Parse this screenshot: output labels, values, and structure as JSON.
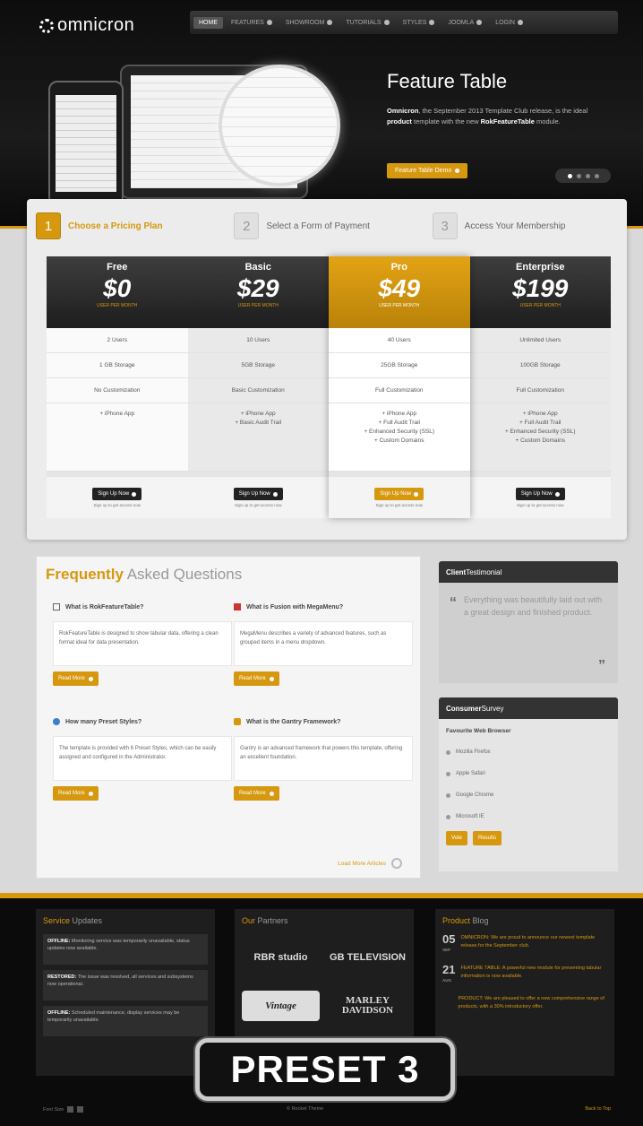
{
  "header": {
    "logo": "omnicron",
    "nav": [
      {
        "label": "HOME",
        "active": true,
        "dropdown": false
      },
      {
        "label": "FEATURES",
        "active": false,
        "dropdown": true
      },
      {
        "label": "SHOWROOM",
        "active": false,
        "dropdown": true
      },
      {
        "label": "TUTORIALS",
        "active": false,
        "dropdown": true
      },
      {
        "label": "STYLES",
        "active": false,
        "dropdown": true
      },
      {
        "label": "JOOMLA",
        "active": false,
        "dropdown": true
      },
      {
        "label": "LOGIN",
        "active": false,
        "dropdown": true
      }
    ]
  },
  "hero": {
    "title": "Feature Table",
    "text_a": "Omnicron",
    "text_b": ", the September 2013 Template Club release, is the ideal ",
    "text_c": "product",
    "text_d": " template with the new ",
    "text_e": "RokFeatureTable",
    "text_f": " module.",
    "button": "Feature Table Demo"
  },
  "steps": [
    {
      "num": "1",
      "label": "Choose a Pricing Plan",
      "active": true
    },
    {
      "num": "2",
      "label": "Select a Form of Payment",
      "active": false
    },
    {
      "num": "3",
      "label": "Access Your Membership",
      "active": false
    }
  ],
  "plans": [
    {
      "name": "Free",
      "price": "$0",
      "per": "USER PER MONTH",
      "users": "2 Users",
      "storage": "1 GB Storage",
      "custom": "No Customization",
      "extras": [
        "+ iPhone App"
      ],
      "signup": "Sign Up Now",
      "note": "Sign up to get access now"
    },
    {
      "name": "Basic",
      "price": "$29",
      "per": "USER PER MONTH",
      "users": "10 Users",
      "storage": "5GB Storage",
      "custom": "Basic Customization",
      "extras": [
        "+ iPhone App",
        "+ Basic Audit Trail"
      ],
      "signup": "Sign Up Now",
      "note": "Sign up to get access now"
    },
    {
      "name": "Pro",
      "price": "$49",
      "per": "USER PER MONTH",
      "users": "40 Users",
      "storage": "25GB Storage",
      "custom": "Full Customization",
      "extras": [
        "+ iPhone App",
        "+ Full Audit Trail",
        "+ Enhanced Security (SSL)",
        "+ Custom Domains"
      ],
      "signup": "Sign Up Now",
      "note": "Sign up to get access now"
    },
    {
      "name": "Enterprise",
      "price": "$199",
      "per": "USER PER MONTH",
      "users": "Unlimited Users",
      "storage": "100GB Storage",
      "custom": "Full Customization",
      "extras": [
        "+ iPhone App",
        "+ Full Audit Trail",
        "+ Enhanced Security (SSL)",
        "+ Custom Domains"
      ],
      "signup": "Sign Up Now",
      "note": "Sign up to get access now"
    }
  ],
  "faq": {
    "title_a": "Frequently",
    "title_b": " Asked Questions",
    "items": [
      {
        "q": "What is RokFeatureTable?",
        "a": "RokFeatureTable is designed to show tabular data, offering a clean format ideal for data presentation.",
        "btn": "Read More"
      },
      {
        "q": "What is Fusion with MegaMenu?",
        "a": "MegaMenu describes a variety of advanced features, such as grouped items in a menu dropdown.",
        "btn": "Read More"
      },
      {
        "q": "How many Preset Styles?",
        "a": "The template is provided with 6 Preset Styles, which can be easily assigned and configured in the Administrator.",
        "btn": "Read More"
      },
      {
        "q": "What is the Gantry Framework?",
        "a": "Gantry is an advanced framework that powers this template, offering an excellent foundation.",
        "btn": "Read More"
      }
    ],
    "load_more": "Load More Articles"
  },
  "sidebar": {
    "testimonial_title_a": "Client",
    "testimonial_title_b": " Testimonial",
    "testimonial": "Everything was beautifully laid out with a great design and finished product.",
    "social_title_a": "Consumer",
    "social_title_b": " Survey",
    "social_label": "Favourite Web Browser",
    "social_items": [
      "Mozilla Firefox",
      "Apple Safari",
      "Google Chrome",
      "Microsoft IE"
    ],
    "btn_vote": "Vote",
    "btn_results": "Results"
  },
  "footer": {
    "updates_title_a": "Service",
    "updates_title_b": " Updates",
    "updates": [
      {
        "lead": "OFFLINE:",
        "text": " Monitoring service was temporarily unavailable, status updates now available."
      },
      {
        "lead": "RESTORED:",
        "text": " The issue was resolved, all services and subsystems now operational."
      },
      {
        "lead": "OFFLINE:",
        "text": " Scheduled maintenance, display services may be temporarily unavailable."
      }
    ],
    "partners_title_a": "Our",
    "partners_title_b": " Partners",
    "partners": [
      "RBR studio",
      "GB TELEVISION",
      "Vintage",
      "MARLEY DAVIDSON"
    ],
    "blog_title_a": "Product",
    "blog_title_b": " Blog",
    "blog": [
      {
        "day": "05",
        "month": "SEP",
        "text": "OMNICRON: We are proud to announce our newest template release for the September club."
      },
      {
        "day": "21",
        "month": "AUG",
        "text": "FEATURE TABLE: A powerful new module for presenting tabular information is now available."
      },
      {
        "day": "",
        "month": "",
        "text": "PRODUCT: We are pleased to offer a new comprehensive range of products, with a 30% introductory offer."
      }
    ],
    "preset_badge": "PRESET 3",
    "left_text": "Font Size",
    "mid_text": "© Rocket Theme",
    "right_text": "Back to Top"
  },
  "colors": {
    "accent": "#d6980f",
    "dark": "#1b1b1b"
  }
}
